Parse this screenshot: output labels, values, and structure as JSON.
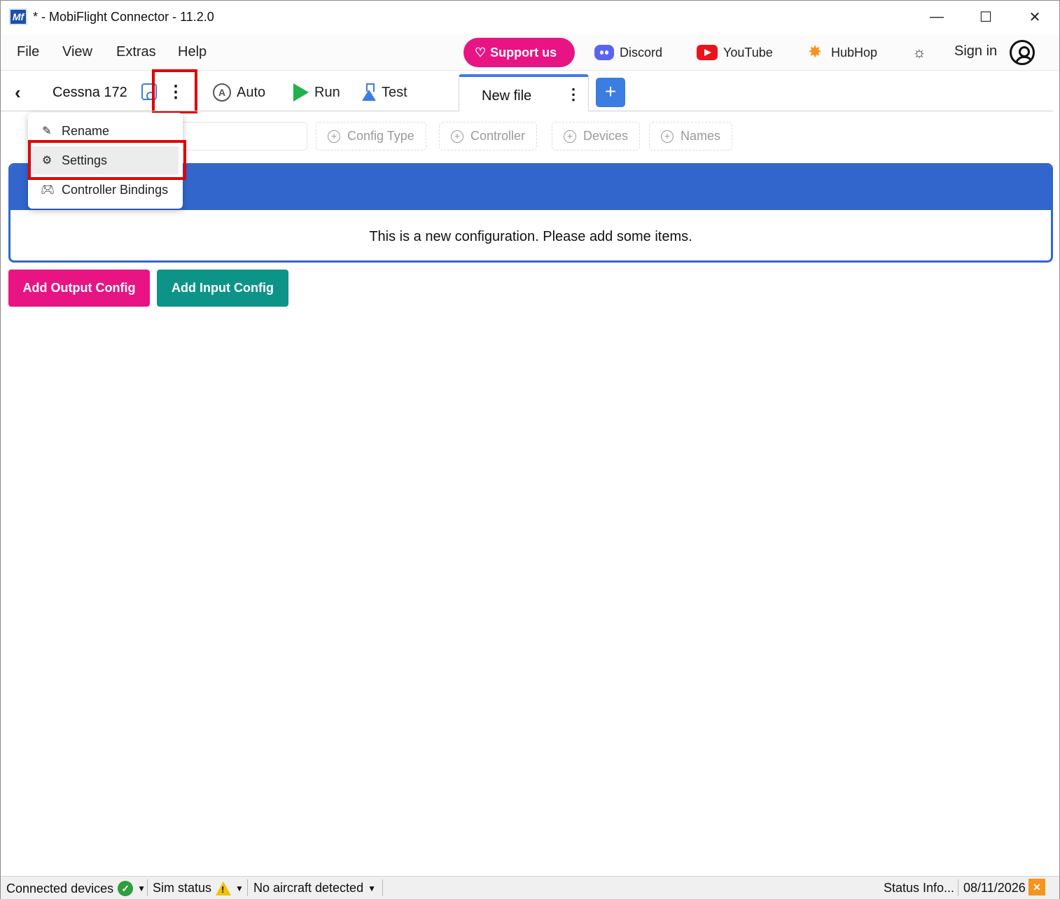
{
  "window": {
    "title": "* - MobiFlight Connector - 11.2.0",
    "logo_text": "Mf",
    "minimize_glyph": "—",
    "maximize_glyph": "☐",
    "close_glyph": "✕"
  },
  "menubar": {
    "items": [
      "File",
      "View",
      "Extras",
      "Help"
    ],
    "support_label": "Support us",
    "discord_label": "Discord",
    "youtube_label": "YouTube",
    "hubhop_label": "HubHop",
    "signin_label": "Sign in"
  },
  "toolbar": {
    "back_glyph": "‹",
    "project_name": "Cessna 172",
    "kebab_glyph": "⋮",
    "auto_label": "Auto",
    "run_label": "Run",
    "test_label": "Test"
  },
  "tabs": [
    {
      "label": "New file",
      "kebab_glyph": "⋮"
    }
  ],
  "add_tab_glyph": "+",
  "filters": {
    "chips": [
      "Config Type",
      "Controller",
      "Devices",
      "Names"
    ]
  },
  "panel": {
    "message": "This is a new configuration. Please add some items."
  },
  "actions": {
    "add_output": "Add Output Config",
    "add_input": "Add Input Config"
  },
  "dropdown": {
    "items": [
      "Rename",
      "Settings",
      "Controller Bindings"
    ],
    "highlighted": "Settings"
  },
  "statusbar": {
    "connected_devices": "Connected devices",
    "sim_status": "Sim status",
    "aircraft": "No aircraft detected",
    "status_info": "Status Info...",
    "date": "08/11/2026"
  },
  "colors": {
    "accent_blue": "#3366cc",
    "support_pink": "#e81483",
    "input_teal": "#0d9488",
    "highlight_red": "#e00000"
  }
}
